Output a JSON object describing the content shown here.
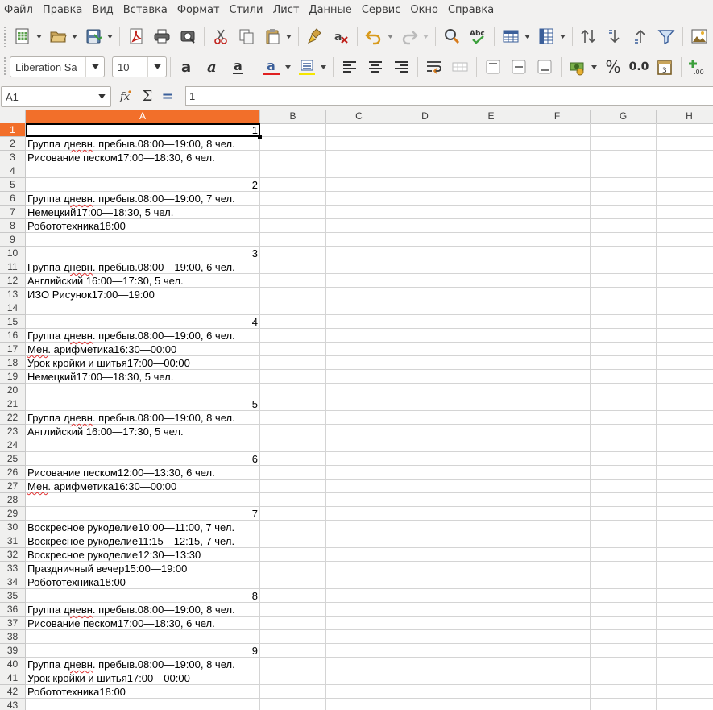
{
  "menubar": {
    "items": [
      "Файл",
      "Правка",
      "Вид",
      "Вставка",
      "Формат",
      "Стили",
      "Лист",
      "Данные",
      "Сервис",
      "Окно",
      "Справка"
    ]
  },
  "toolbar2": {
    "font_name": "Liberation Sa",
    "font_size": "10",
    "percent_label": "%",
    "number_label": "0.0"
  },
  "formulabar": {
    "cell_ref": "A1",
    "formula": "1",
    "sum_label": "Σ",
    "equals_label": "="
  },
  "grid": {
    "columns": [
      "A",
      "B",
      "C",
      "D",
      "E",
      "F",
      "G",
      "H"
    ],
    "selected_column": "A",
    "selected_row": 1,
    "rows": [
      {
        "n": 1,
        "text": "1",
        "type": "num"
      },
      {
        "n": 2,
        "pre": "Группа ",
        "squig": "дневн",
        "post": ". пребыв.08:00—19:00, 8 чел."
      },
      {
        "n": 3,
        "text": "Рисование песком17:00—18:30, 6 чел."
      },
      {
        "n": 4,
        "text": ""
      },
      {
        "n": 5,
        "text": "2",
        "type": "num"
      },
      {
        "n": 6,
        "pre": "Группа ",
        "squig": "дневн",
        "post": ". пребыв.08:00—19:00, 7 чел."
      },
      {
        "n": 7,
        "text": "Немецкий17:00—18:30, 5 чел."
      },
      {
        "n": 8,
        "text": "Робототехника18:00"
      },
      {
        "n": 9,
        "text": ""
      },
      {
        "n": 10,
        "text": "3",
        "type": "num"
      },
      {
        "n": 11,
        "pre": "Группа ",
        "squig": "дневн",
        "post": ". пребыв.08:00—19:00, 6 чел."
      },
      {
        "n": 12,
        "text": "Английский 16:00—17:30, 5 чел."
      },
      {
        "n": 13,
        "text": "ИЗО Рисунок17:00—19:00"
      },
      {
        "n": 14,
        "text": ""
      },
      {
        "n": 15,
        "text": "4",
        "type": "num"
      },
      {
        "n": 16,
        "pre": "Группа ",
        "squig": "дневн",
        "post": ". пребыв.08:00—19:00, 6 чел."
      },
      {
        "n": 17,
        "pre": "",
        "squig": "Мен",
        "post": ". арифметика16:30—00:00"
      },
      {
        "n": 18,
        "text": "Урок кройки и шитья17:00—00:00"
      },
      {
        "n": 19,
        "text": "Немецкий17:00—18:30, 5 чел."
      },
      {
        "n": 20,
        "text": ""
      },
      {
        "n": 21,
        "text": "5",
        "type": "num"
      },
      {
        "n": 22,
        "pre": "Группа ",
        "squig": "дневн",
        "post": ". пребыв.08:00—19:00, 8 чел."
      },
      {
        "n": 23,
        "text": "Английский 16:00—17:30, 5 чел."
      },
      {
        "n": 24,
        "text": ""
      },
      {
        "n": 25,
        "text": "6",
        "type": "num"
      },
      {
        "n": 26,
        "text": "Рисование песком12:00—13:30, 6 чел."
      },
      {
        "n": 27,
        "pre": "",
        "squig": "Мен",
        "post": ". арифметика16:30—00:00"
      },
      {
        "n": 28,
        "text": ""
      },
      {
        "n": 29,
        "text": "7",
        "type": "num"
      },
      {
        "n": 30,
        "text": "Воскресное рукоделие10:00—11:00, 7 чел."
      },
      {
        "n": 31,
        "text": "Воскресное рукоделие11:15—12:15, 7 чел."
      },
      {
        "n": 32,
        "text": "Воскресное рукоделие12:30—13:30"
      },
      {
        "n": 33,
        "text": "Праздничный вечер15:00—19:00"
      },
      {
        "n": 34,
        "text": "Робототехника18:00"
      },
      {
        "n": 35,
        "text": "8",
        "type": "num"
      },
      {
        "n": 36,
        "pre": "Группа ",
        "squig": "дневн",
        "post": ". пребыв.08:00—19:00, 8 чел."
      },
      {
        "n": 37,
        "text": "Рисование песком17:00—18:30, 6 чел."
      },
      {
        "n": 38,
        "text": ""
      },
      {
        "n": 39,
        "text": "9",
        "type": "num"
      },
      {
        "n": 40,
        "pre": "Группа ",
        "squig": "дневн",
        "post": ". пребыв.08:00—19:00, 8 чел."
      },
      {
        "n": 41,
        "text": "Урок кройки и шитья17:00—00:00"
      },
      {
        "n": 42,
        "text": "Робототехника18:00"
      },
      {
        "n": 43,
        "text": ""
      }
    ]
  },
  "colors": {
    "selection_accent": "#f26f2a",
    "font_color_bar": "#e02020",
    "highlight_bar": "#f5e600",
    "spell_error": "#e03030"
  }
}
